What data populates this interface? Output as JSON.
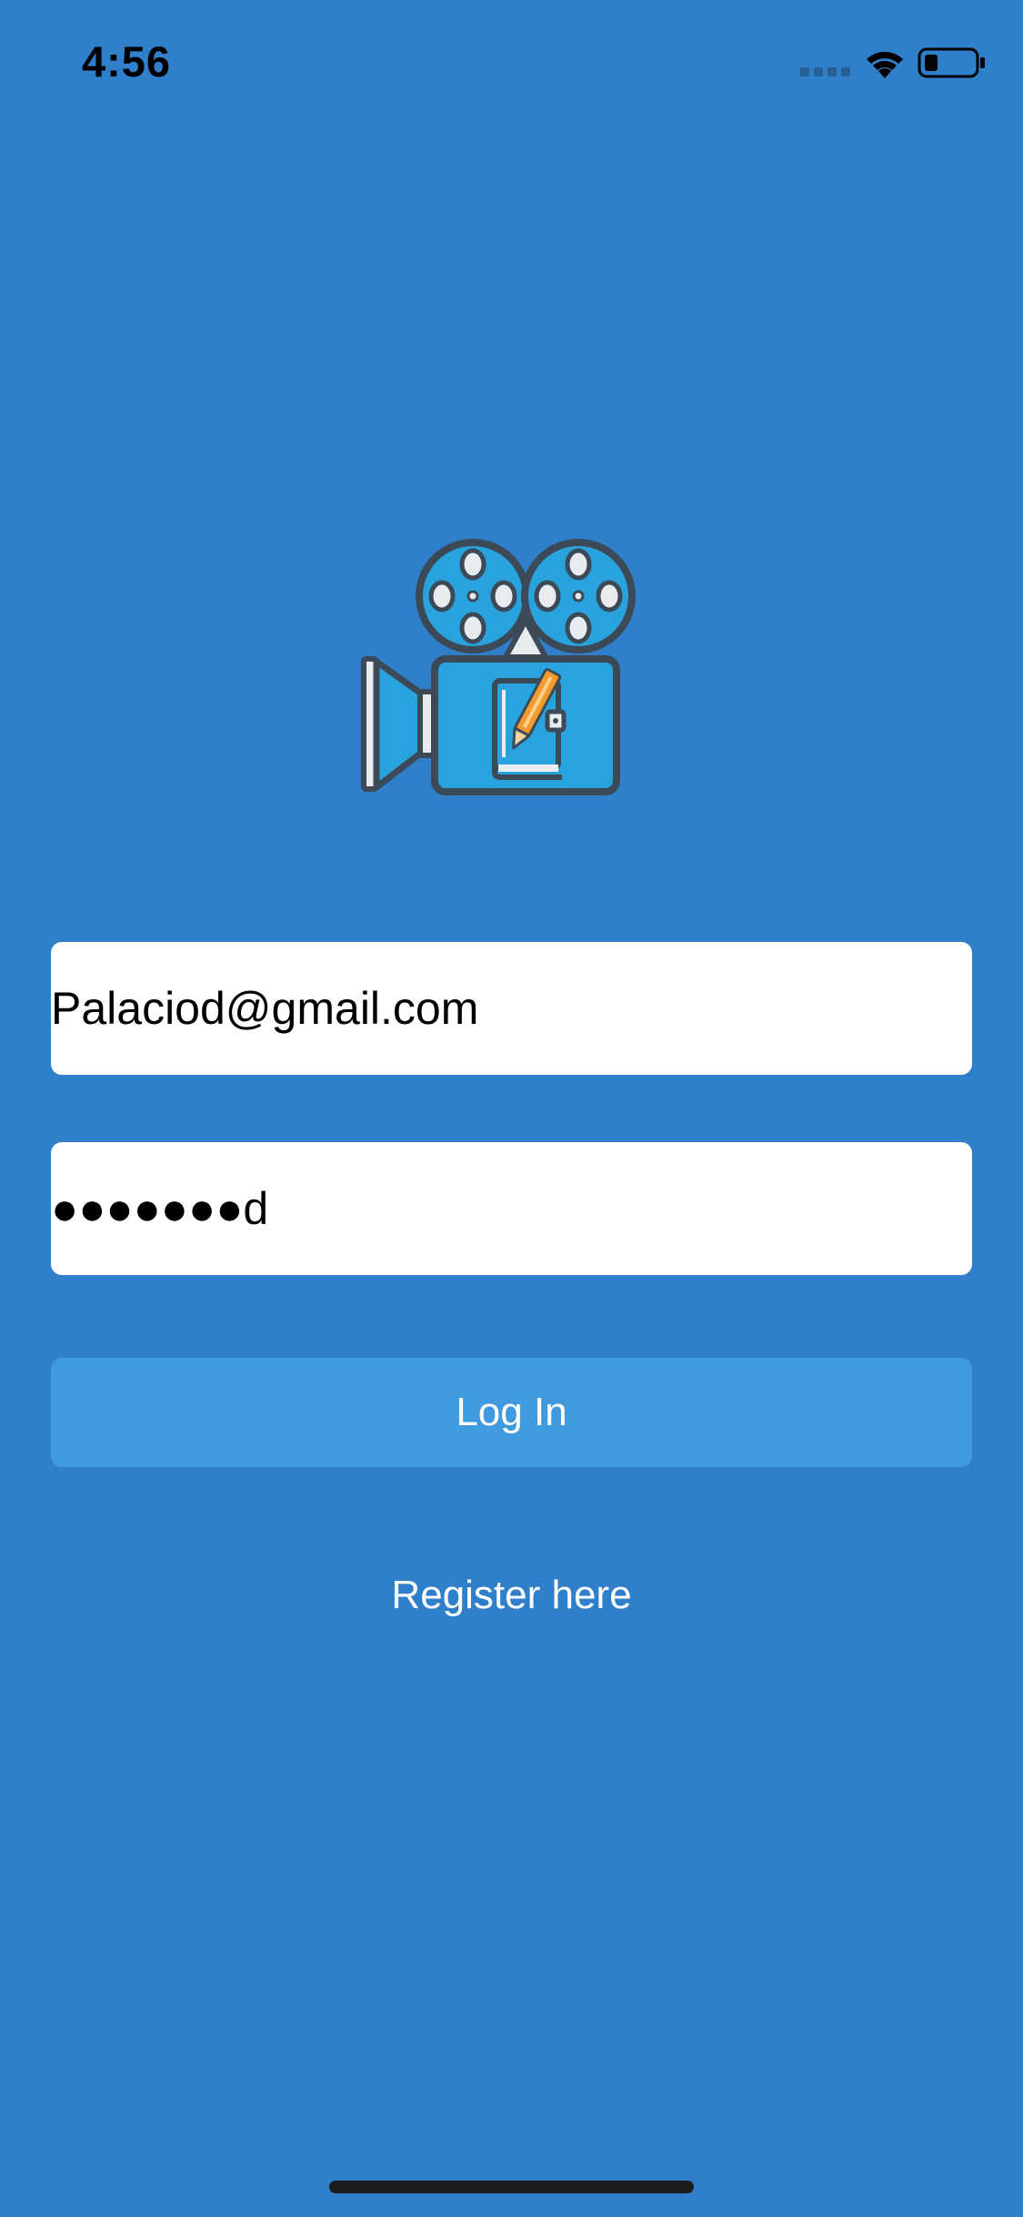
{
  "status_bar": {
    "time": "4:56"
  },
  "login_form": {
    "email_value": "Palaciod@gmail.com",
    "password_display": "●●●●●●●d",
    "login_label": "Log In",
    "register_label": "Register here"
  },
  "colors": {
    "background": "#2f7fca",
    "button": "#3f9bdd",
    "logo_blue": "#29a3dd",
    "logo_outline": "#3c4a57",
    "pencil": "#f29a2e"
  },
  "icons": {
    "logo": "film-camera-notebook-pencil",
    "signal": "cellular-signal",
    "wifi": "wifi",
    "battery": "battery-low"
  }
}
